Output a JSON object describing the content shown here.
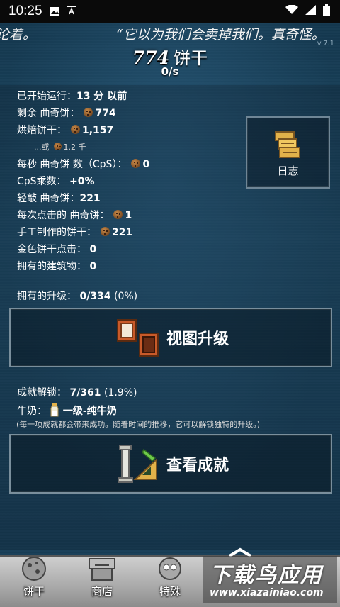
{
  "status_bar": {
    "time": "10:25"
  },
  "ticker": {
    "left_text": "论着。",
    "right_text": "“它以为我们会卖掉我们。真奇怪。",
    "version": "v.7.1"
  },
  "cookies": {
    "count": "774",
    "unit": "饼干",
    "per_second": "0/s"
  },
  "stats": {
    "started_label": "已开始运行：",
    "started_value": "13 分 以前",
    "remaining_label": "剩余 曲奇饼：",
    "remaining_value": "774",
    "baked_label": "烘焙饼干：",
    "baked_value": "1,157",
    "baked_alt_prefix": "...或",
    "baked_alt_value": "1.2 千",
    "cps_label": "每秒 曲奇饼 数（CpS）：",
    "cps_value": "0",
    "multiplier_label": "CpS乘数：",
    "multiplier_value": "+0%",
    "clicked_label": "轻敲 曲奇饼：",
    "clicked_value": "221",
    "per_click_label": "每次点击的 曲奇饼：",
    "per_click_value": "1",
    "handmade_label": "手工制作的饼干：",
    "handmade_value": "221",
    "golden_label": "金色饼干点击：",
    "golden_value": "0",
    "buildings_label": "拥有的建筑物：",
    "buildings_value": "0",
    "upgrades_label": "拥有的升级：",
    "upgrades_value": "0/334",
    "upgrades_pct": "(0%)",
    "achievements_label": "成就解锁：",
    "achievements_value": "7/361",
    "achievements_pct": "(1.9%)",
    "milk_label": "牛奶：",
    "milk_value": "一级-纯牛奶",
    "milk_note": "(每一项成就都会带来成功。随着时间的推移，它可以解锁独特的升级。)"
  },
  "buttons": {
    "log": "日志",
    "view_upgrades": "视图升级",
    "view_achievements": "查看成就"
  },
  "tabs": [
    "饼干",
    "商店",
    "特殊"
  ],
  "watermark": {
    "main": "下载鸟应用",
    "sub": "www.xiazainiao.com"
  },
  "colors": {
    "background": "#1d3f57",
    "accent_gold": "#e2b24a"
  }
}
